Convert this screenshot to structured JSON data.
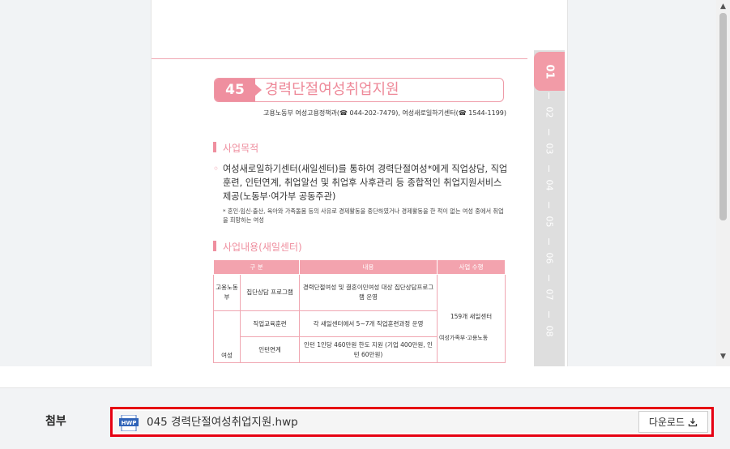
{
  "document": {
    "number": "45",
    "title": "경력단절여성취업지원",
    "contact": "고용노동부 여성고용정책과(☎ 044-202-7479), 여성새로일하기센터(☎ 1544-1199)",
    "section1_heading": "사업목적",
    "purpose_text": "여성새로일하기센터(새일센터)를 통하여 경력단절여성*에게 직업상담, 직업훈련, 인턴연계, 취업알선 및 취업후 사후관리 등 종합적인 취업지원서비스 제공(노동부·여가부 공동주관)",
    "footnote": "* 혼인·임신·출산, 육아와 가족돌봄 등의 사유로 경제활동을 중단하였거나 경제활동을 한 적이 없는 여성 중에서 취업을 희망하는 여성",
    "section2_heading": "사업내용(새일센터)",
    "table": {
      "headers": [
        "구 분",
        "내용",
        "사업 수행"
      ],
      "rows": [
        {
          "group": "고용노동부",
          "item": "집단상담 프로그램",
          "content": "경력단절여성 및 결혼이민여성 대상 집단상담프로그램 운영"
        },
        {
          "group": "",
          "item": "직업교육훈련",
          "content": "각 새일센터에서 5~7개 직업훈련과정 운영"
        },
        {
          "group": "여성",
          "item": "인턴연계",
          "content": "인턴 1인당 460만원 한도 지원 (기업 400만원, 인턴 60만원)"
        }
      ],
      "agency": "159개 새일센터",
      "agency_note": "여성가족부·고용노동"
    }
  },
  "tabs": [
    "01",
    "02",
    "03",
    "04",
    "05",
    "06",
    "07",
    "08"
  ],
  "scrollbar": {
    "up": "▲",
    "down": "▼"
  },
  "attachment": {
    "label": "첨부",
    "file_icon": "hwp-file-icon",
    "file_icon_text": "HWP",
    "file_name": "045 경력단절여성취업지원.hwp",
    "download_label": "다운로드"
  }
}
